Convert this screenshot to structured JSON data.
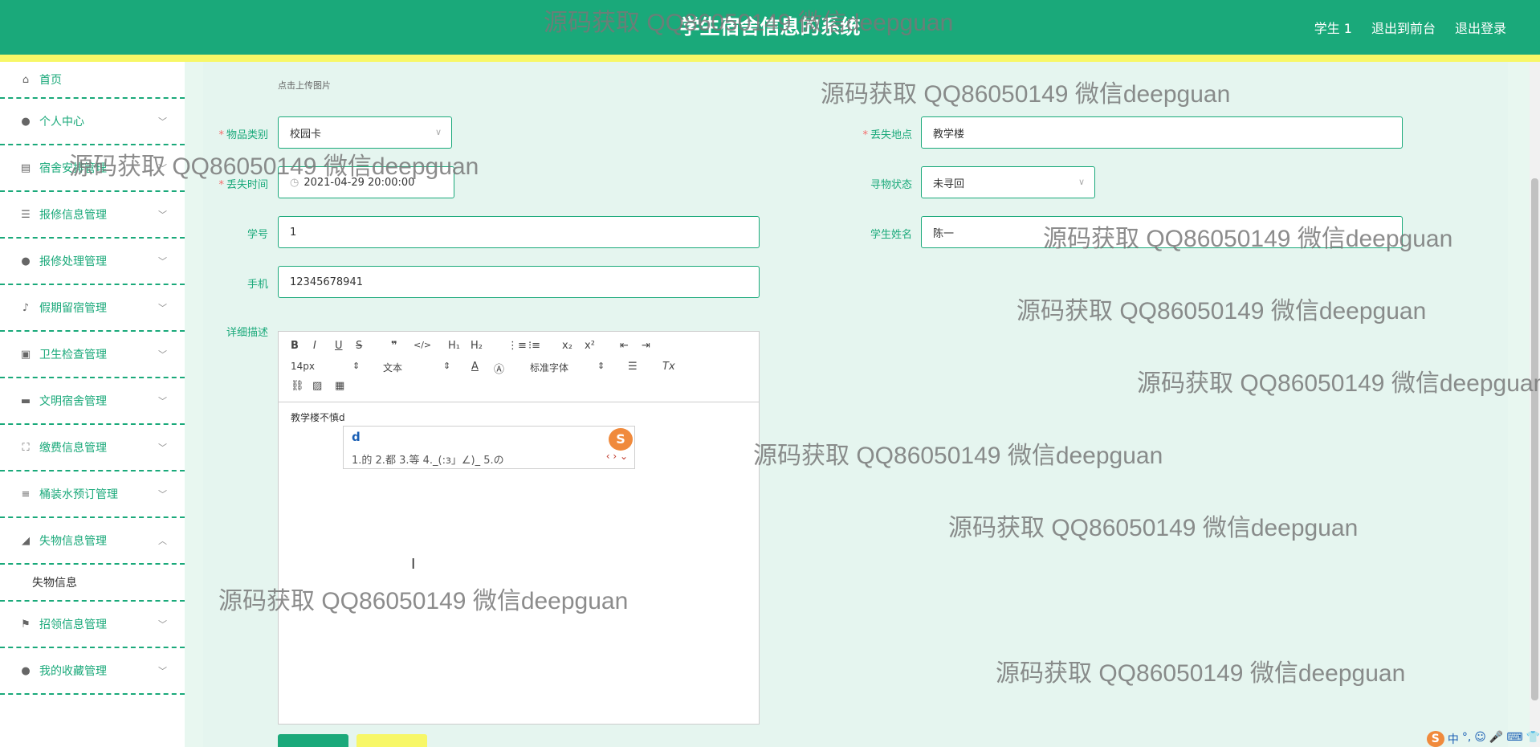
{
  "header": {
    "title": "学生宿舍信息的系统",
    "links": [
      "学生 1",
      "退出到前台",
      "退出登录"
    ]
  },
  "sidebar": {
    "items": [
      {
        "label": "首页",
        "icon": "home-icon",
        "chev": ""
      },
      {
        "label": "个人中心",
        "icon": "user-icon",
        "chev": "﹀"
      },
      {
        "label": "宿舍安排管理",
        "icon": "doc-icon",
        "chev": "﹀"
      },
      {
        "label": "报修信息管理",
        "icon": "sliders-icon",
        "chev": "﹀"
      },
      {
        "label": "报修处理管理",
        "icon": "user-icon",
        "chev": "﹀"
      },
      {
        "label": "假期留宿管理",
        "icon": "mic-icon",
        "chev": "﹀"
      },
      {
        "label": "卫生检查管理",
        "icon": "briefcase-icon",
        "chev": "﹀"
      },
      {
        "label": "文明宿舍管理",
        "icon": "book-icon",
        "chev": "﹀"
      },
      {
        "label": "缴费信息管理",
        "icon": "scan-icon",
        "chev": "﹀"
      },
      {
        "label": "桶装水预订管理",
        "icon": "list-icon",
        "chev": "﹀"
      },
      {
        "label": "失物信息管理",
        "icon": "chart-icon",
        "chev": "︿"
      },
      {
        "label": "招领信息管理",
        "icon": "flag-icon",
        "chev": "﹀"
      },
      {
        "label": "我的收藏管理",
        "icon": "user-icon",
        "chev": "﹀"
      }
    ],
    "sub_item": "失物信息"
  },
  "form": {
    "upload_hint": "点击上传图片",
    "category_label": "物品类别",
    "category_value": "校园卡",
    "location_label": "丢失地点",
    "location_value": "教学楼",
    "time_label": "丢失时间",
    "time_value": "2021-04-29 20:00:00",
    "status_label": "寻物状态",
    "status_value": "未寻回",
    "student_no_label": "学号",
    "student_no_value": "1",
    "student_name_label": "学生姓名",
    "student_name_value": "陈一",
    "phone_label": "手机",
    "phone_value": "12345678941",
    "desc_label": "详细描述"
  },
  "editor": {
    "font_size": "14px",
    "format": "文本",
    "font_family": "标准字体",
    "content": "教学楼不慎d"
  },
  "ime": {
    "input": "d",
    "candidates": "1.的  2.都  3.等  4._(:з」∠)_  5.の",
    "candidate_first": "1.的"
  },
  "watermark": "源码获取 QQ86050149 微信deepguan",
  "tray": [
    "中",
    "°,",
    "☺",
    "🎤",
    "⌨",
    "👕"
  ]
}
